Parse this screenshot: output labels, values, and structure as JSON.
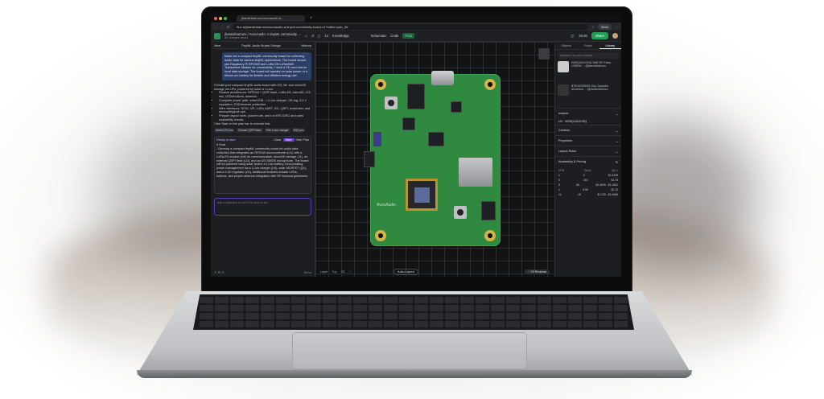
{
  "browser": {
    "tab_title": "jharwinbarrozo/avocaudio-a...",
    "url": "flux.ai/jharwinbarrozo/avocaudio-a-tinyml-community-board-c1?editor=pcb_3d",
    "profile_label": "Work"
  },
  "header": {
    "project_title": "jharwinbarrozo / AvocAudio: A tinyML community ...",
    "project_sub": "All changes saved",
    "count_a": "0",
    "count_b": "14",
    "knowledge_label": "Knowledge",
    "schematic_label": "Schematic",
    "code_label": "Code",
    "pcb_label": "PCB",
    "credits": "20.00",
    "share_label": "Share"
  },
  "chat": {
    "new_label": "New",
    "panel_title": "TinyML Audio Board Design",
    "history_label": "History",
    "user_message": "Make me a compact tinyML community board for collecting audio data for various tinyML applications. The board should use Raspberry Pi RP2040 and LoRa E5 LoRaWAN Transceiver Module for connectivity. I need a SD card slot for local data storage. The board will operate on solar power or a lithium-ion battery for flexible and efficient energy use.",
    "answer_intro": "I'll build your compact tinyML audio board with I2S, ML and microSD storage via LiPo, powered by solar or Li-ion.",
    "bullets": [
      "Finalize architecture: RP2040 + QSPI flash, LoRa-E5, microSD, I2S mic, LEDs/buttons, antenna.",
      "Complete power path: solar/USB -> Li-ion charger, OR-ing, 3.3 V regulation, ESD/reverse protection.",
      "Wire interfaces: SDIO, I2S, LoRa UART, I2C, QSPI, boot/reset; add decoupling/pull-ups.",
      "Prepare layout rules, place/route, and run ERC/DRC and parts availability checks."
    ],
    "answer_outro": "Click Start on the plan bar to execute this.",
    "chips": [
      "Select I2S mic",
      "Choose QSPI flash",
      "Pick Li-ion charger",
      "ESD pro"
    ],
    "plan_status": "Ready to start",
    "clear_label": "Clear",
    "start_label": "Start",
    "hide_plan_label": "Hide Plan",
    "plan_heading": "# Goal",
    "plan_body": "- Develop a compact tinyML community board for audio data collection that integrates an RP2040 microcontroller (U1) with a LoRa-E5 module (U4) for communication, microSD storage (J1), an external QSPI flash (U2), and an I2S MEMS microphone. The board will be powered using solar and/or a Li-ion battery, incorporating power management via a Li-ion charger (U5), solar MOSFET (Q1), and a 3.3V regulator (U4). Additional features include LEDs, buttons, and proper antenna integration with RF keepout guidelines.",
    "ask_placeholder": "Ask a question or tell Flux what to do...",
    "send_label": "Send"
  },
  "canvas": {
    "brand_label": "AvocAudio",
    "zoom_label": "3D",
    "layer_a": "Layer",
    "layer_b": "Top",
    "autolayout_label": "Auto-Layout",
    "errors": "1",
    "reviews_count": "78",
    "reviews_label": "Reviews"
  },
  "right": {
    "tabs": [
      "Objects",
      "Rules",
      "Library"
    ],
    "search_placeholder": "Keyword or part number",
    "part1": "W25Q16JVSSIQ  2MB SPI Flash, 133MHz ... @jharwinbarrozo",
    "part2": "B75100293005  Chip Capacitor Aluminum ... @jharwinbarrozo",
    "inspect_label": "Inspect",
    "inspect_value": "U2 · W25Q128JVSQ",
    "controls_label": "Controls",
    "properties_label": "Properties",
    "layout_rules_label": "Layout Rules",
    "avail_label": "Availability & Pricing",
    "avail_headers": [
      "DPN",
      "Stock",
      "Qty 1"
    ],
    "avail_rows": [
      [
        "1",
        "0",
        "$1.2349"
      ],
      [
        "3",
        "74K",
        "$1.75"
      ],
      [
        "5",
        "6K",
        "$1.0805 - $1.1651"
      ],
      [
        "1",
        "6.9K",
        "$2.10"
      ],
      [
        "14",
        "1K",
        "$1.100 - $1.8465"
      ]
    ]
  }
}
